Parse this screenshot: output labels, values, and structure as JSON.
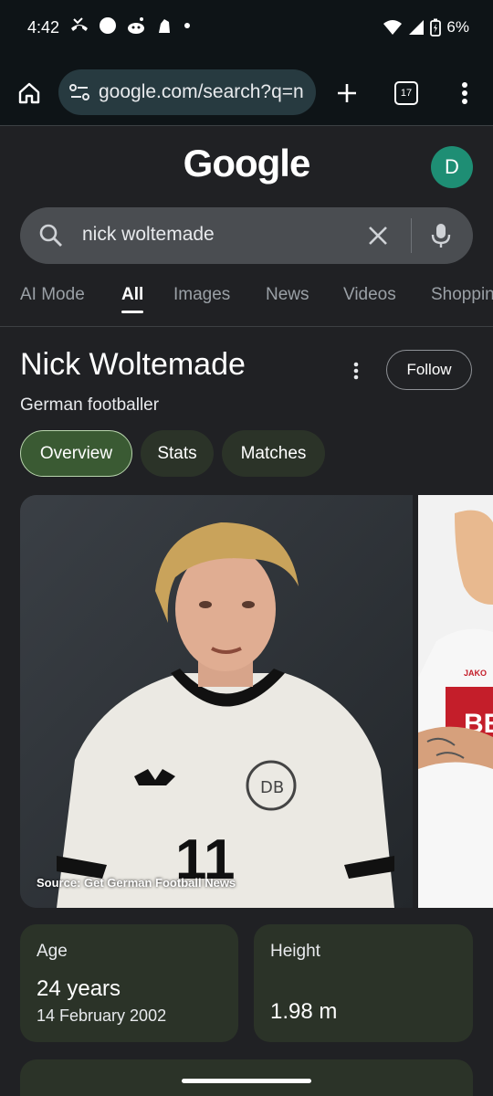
{
  "status": {
    "time": "4:42",
    "battery": "6%",
    "left_icons": [
      "missed-call-icon",
      "circle-icon",
      "reddit-icon",
      "premier-league-icon",
      "dot-icon"
    ],
    "right_icons": [
      "wifi-icon",
      "signal-icon",
      "battery-charging-icon"
    ]
  },
  "browser": {
    "url": "google.com/search?q=n",
    "tab_count": "17"
  },
  "google": {
    "logo_text": "Google",
    "avatar_letter": "D",
    "avatar_color": "#1e8e74"
  },
  "search": {
    "query": "nick woltemade"
  },
  "tabs": [
    {
      "label": "AI Mode"
    },
    {
      "label": "All"
    },
    {
      "label": "Images"
    },
    {
      "label": "News"
    },
    {
      "label": "Videos"
    },
    {
      "label": "Shopping"
    }
  ],
  "entity": {
    "name": "Nick Woltemade",
    "description": "German footballer",
    "follow_label": "Follow",
    "chips": [
      {
        "label": "Overview"
      },
      {
        "label": "Stats"
      },
      {
        "label": "Matches"
      }
    ],
    "image_source": "Source: Get German Football News",
    "jersey_number": "11",
    "side_brand": "JAKO"
  },
  "facts": {
    "age_label": "Age",
    "age_value": "24 years",
    "age_sub": "14 February 2002",
    "height_label": "Height",
    "height_value": "1.98 m"
  },
  "colors": {
    "background": "#202124",
    "chip_active": "#3a5a33",
    "card": "#2b3328",
    "search_box": "#4a4d51"
  }
}
